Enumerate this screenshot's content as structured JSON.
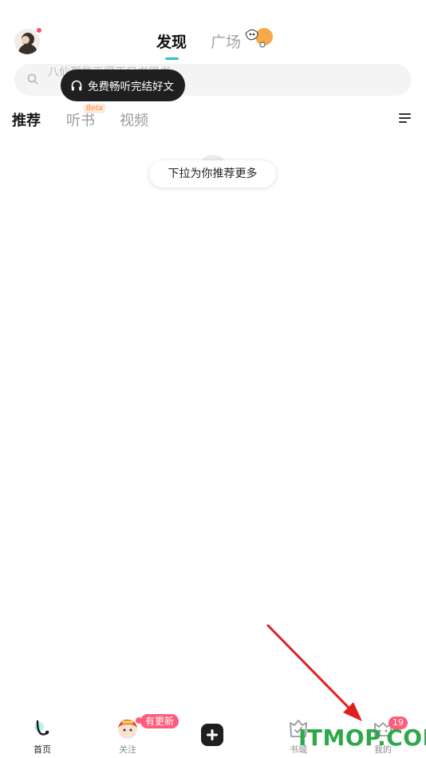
{
  "header": {
    "tabs": [
      {
        "label": "发现",
        "active": true
      },
      {
        "label": "广场",
        "active": false
      }
    ],
    "accent_color": "#2bc7c0"
  },
  "search": {
    "placeholder": "八仙那些天得天只书很书",
    "tooltip": "免费畅听完结好文",
    "tooltip_icon": "headphones-icon"
  },
  "categories": {
    "items": [
      "推荐",
      "听书",
      "视频"
    ],
    "beta_label": "Beta"
  },
  "feed": {
    "pull_hint": "下拉为你推荐更多"
  },
  "bottom_nav": {
    "items": [
      {
        "label": "首页",
        "icon": "home-icon",
        "active": true
      },
      {
        "label": "关注",
        "icon": "follow-avatar-icon",
        "badge": "有更新"
      },
      {
        "label": "",
        "icon": "plus-icon"
      },
      {
        "label": "书城",
        "icon": "bookstore-icon"
      },
      {
        "label": "我的",
        "icon": "profile-icon",
        "badge": "19"
      }
    ],
    "badge_color": "#ff5b7a"
  },
  "watermark": {
    "text": "ITMOP.COM",
    "color": "#2ea84a"
  },
  "annotation": {
    "arrow_color": "#e02020"
  }
}
